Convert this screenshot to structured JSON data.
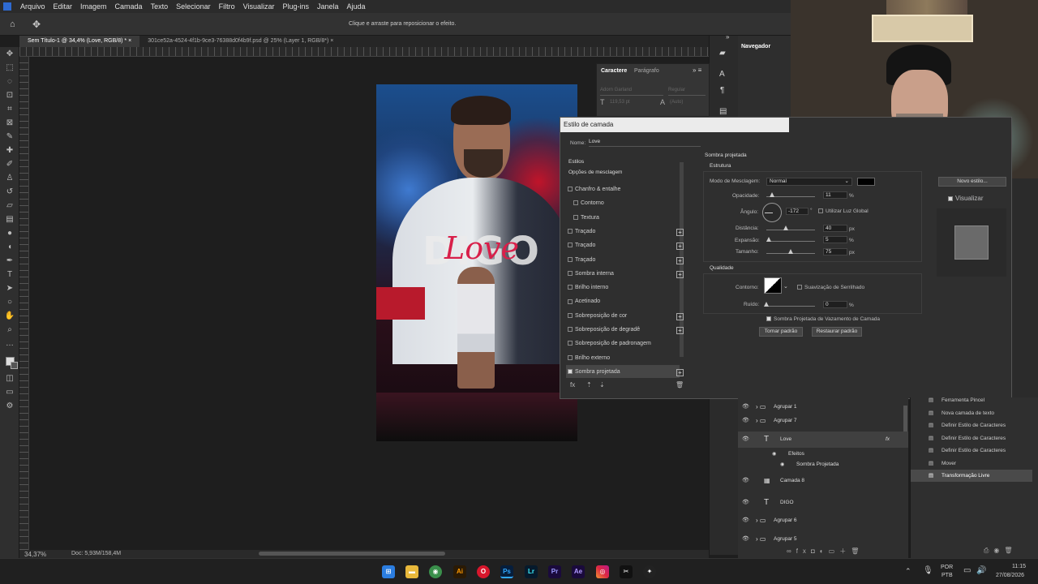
{
  "menu": [
    "Arquivo",
    "Editar",
    "Imagem",
    "Camada",
    "Texto",
    "Selecionar",
    "Filtro",
    "Visualizar",
    "Plug-ins",
    "Janela",
    "Ajuda"
  ],
  "options_hint": "Clique e arraste para reposicionar o efeito.",
  "tabs": [
    "Sem Título-1 @ 34,4% (Love, RGB/8) *",
    "301ce52a-4524-4f1b-9ce3-76388d0f4b9f.psd @ 25% (Layer 1, RGB/8*)"
  ],
  "status": {
    "zoom": "34,37%",
    "doc": "Doc: 5,93M/158,4M"
  },
  "character_panel": {
    "tabs": [
      "Caractere",
      "Parágrafo"
    ],
    "font": "Adorn Garland",
    "style": "Regular",
    "size": "119,53 pt",
    "leading": "(Auto)"
  },
  "navigator": {
    "title": "Navegador"
  },
  "poster": {
    "title": "DIGO",
    "script": "Love"
  },
  "dialog": {
    "title": "Estilo de camada",
    "name_label": "Nome:",
    "name_value": "Love",
    "styles_header": "Estilos",
    "blend_options": "Opções de mesclagem",
    "styles": [
      {
        "label": "Chanfro & entalhe",
        "checked": false,
        "plus": false,
        "indent": false
      },
      {
        "label": "Contorno",
        "checked": false,
        "plus": false,
        "indent": true
      },
      {
        "label": "Textura",
        "checked": false,
        "plus": false,
        "indent": true
      },
      {
        "label": "Traçado",
        "checked": false,
        "plus": true,
        "indent": false
      },
      {
        "label": "Traçado",
        "checked": false,
        "plus": true,
        "indent": false
      },
      {
        "label": "Traçado",
        "checked": false,
        "plus": true,
        "indent": false
      },
      {
        "label": "Sombra interna",
        "checked": false,
        "plus": true,
        "indent": false
      },
      {
        "label": "Brilho interno",
        "checked": false,
        "plus": false,
        "indent": false
      },
      {
        "label": "Acetinado",
        "checked": false,
        "plus": false,
        "indent": false
      },
      {
        "label": "Sobreposição de cor",
        "checked": false,
        "plus": true,
        "indent": false
      },
      {
        "label": "Sobreposição de degradê",
        "checked": false,
        "plus": true,
        "indent": false
      },
      {
        "label": "Sobreposição de padronagem",
        "checked": false,
        "plus": false,
        "indent": false
      },
      {
        "label": "Brilho externo",
        "checked": false,
        "plus": false,
        "indent": false
      },
      {
        "label": "Sombra projetada",
        "checked": true,
        "plus": true,
        "indent": false
      }
    ],
    "section_title": "Sombra projetada",
    "structure": "Estrutura",
    "blend_mode_label": "Modo de Mesclagem:",
    "blend_mode": "Normal",
    "opacity_label": "Opacidade:",
    "opacity": "11",
    "opacity_unit": "%",
    "opacity_level": 0.11,
    "angle_label": "Ângulo:",
    "angle": "-172",
    "angle_unit": "°",
    "global_light": "Utilizar Luz Global",
    "distance_label": "Distância:",
    "distance": "40",
    "distance_unit": "px",
    "distance_level": 0.4,
    "spread_label": "Expansão:",
    "spread": "5",
    "spread_unit": "%",
    "spread_level": 0.05,
    "size_label": "Tamanho:",
    "size": "75",
    "size_unit": "px",
    "size_level": 0.5,
    "quality": "Qualidade",
    "contour_label": "Contorno:",
    "antialias": "Suavização de Serrilhado",
    "noise_label": "Ruído:",
    "noise": "0",
    "noise_unit": "%",
    "knockout": "Sombra Projetada de Vazamento de Camada",
    "make_default": "Tornar padrão",
    "reset_default": "Restaurar padrão",
    "new_style": "Novo estilo...",
    "preview": "Visualizar"
  },
  "layers": [
    {
      "name": "Agrupar 1",
      "type": "group",
      "indent": 1
    },
    {
      "name": "Agrupar 7",
      "type": "group",
      "indent": 1
    },
    {
      "name": "Love",
      "type": "text",
      "indent": 2,
      "fx": "fx"
    },
    {
      "name": "Efeitos",
      "type": "effects",
      "indent": 3
    },
    {
      "name": "Sombra Projetada",
      "type": "effect",
      "indent": 4
    },
    {
      "name": "Camada 8",
      "type": "image",
      "indent": 2
    },
    {
      "name": "DIGO",
      "type": "text",
      "indent": 2
    },
    {
      "name": "Agrupar 6",
      "type": "group",
      "indent": 1
    },
    {
      "name": "Agrupar 5",
      "type": "group",
      "indent": 1
    }
  ],
  "history": [
    "Ferramenta Pincel",
    "Nova camada de texto",
    "Definir Estilo de Caracteres",
    "Definir Estilo de Caracteres",
    "Definir Estilo de Caracteres",
    "Mover",
    "Transformação Livre"
  ],
  "taskbar": {
    "lang": "POR",
    "region": "PTB",
    "time": "11:15",
    "date": "27/08/2026"
  }
}
